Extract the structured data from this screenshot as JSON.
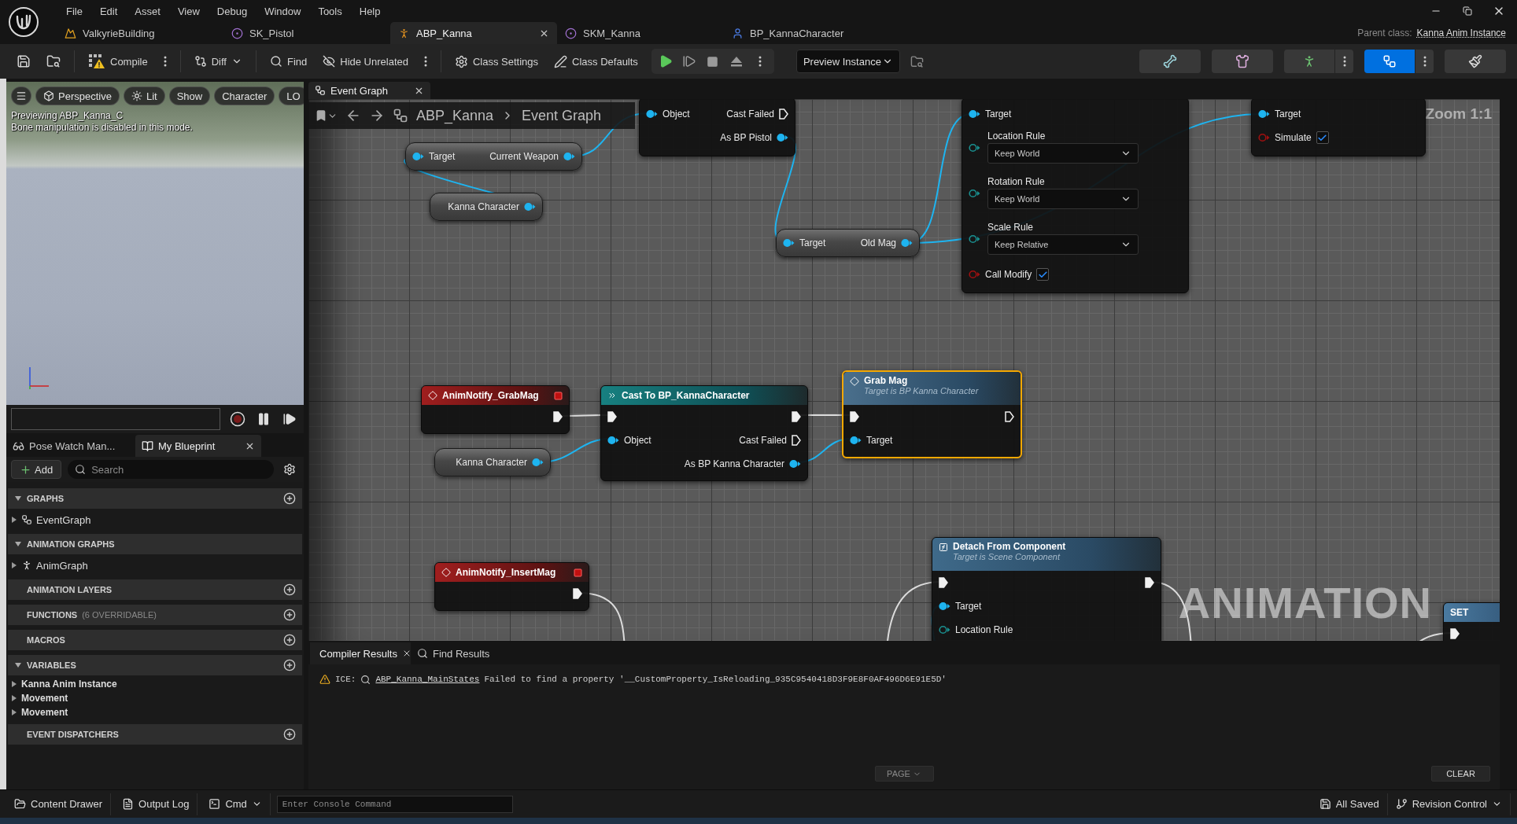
{
  "menu": [
    "File",
    "Edit",
    "Asset",
    "View",
    "Debug",
    "Window",
    "Tools",
    "Help"
  ],
  "document_tabs": [
    {
      "label": "ValkyrieBuilding",
      "kind": "level",
      "selected": false
    },
    {
      "label": "SK_Pistol",
      "kind": "skeleton",
      "selected": false
    },
    {
      "label": "ABP_Kanna",
      "kind": "anim_blueprint",
      "selected": true
    },
    {
      "label": "SKM_Kanna",
      "kind": "mesh",
      "selected": false
    },
    {
      "label": "BP_KannaCharacter",
      "kind": "blueprint",
      "selected": false
    }
  ],
  "parent_class": {
    "label": "Parent class:",
    "value": "Kanna Anim Instance"
  },
  "toolbar": {
    "compile": "Compile",
    "diff": "Diff",
    "find": "Find",
    "hide_unrelated": "Hide Unrelated",
    "class_settings": "Class Settings",
    "class_defaults": "Class Defaults",
    "debug_object": "Preview Instance",
    "modes": [
      {
        "kind": "skeleton",
        "selected": false,
        "menu": false
      },
      {
        "kind": "mesh",
        "selected": false,
        "menu": false
      },
      {
        "kind": "animation",
        "selected": false,
        "menu": true
      },
      {
        "kind": "graph",
        "selected": true,
        "menu": true
      },
      {
        "kind": "physics",
        "selected": false,
        "menu": false
      }
    ]
  },
  "viewport": {
    "buttons": [
      {
        "label": "Perspective",
        "kind": "camera"
      },
      {
        "label": "Lit",
        "kind": "lighting"
      },
      {
        "label": "Show",
        "kind": "plain"
      },
      {
        "label": "Character",
        "kind": "plain"
      },
      {
        "label": "LO",
        "kind": "plain"
      }
    ],
    "messages": [
      "Previewing ABP_Kanna_C",
      "Bone manipulation is disabled in this mode."
    ]
  },
  "panel_tabs": [
    {
      "label": "Pose Watch Man...",
      "kind": "pose_watch",
      "selected": false
    },
    {
      "label": "My Blueprint",
      "kind": "blueprint",
      "selected": true
    }
  ],
  "my_blueprint": {
    "add": "Add",
    "search": {
      "placeholder": "Search"
    },
    "sections": [
      {
        "title": "GRAPHS",
        "expanded": true,
        "addable": true,
        "items": [
          {
            "label": "EventGraph",
            "kind": "graph",
            "expanded": false
          }
        ]
      },
      {
        "title": "ANIMATION GRAPHS",
        "expanded": true,
        "addable": false,
        "items": [
          {
            "label": "AnimGraph",
            "kind": "anim_graph",
            "expanded": false
          }
        ]
      },
      {
        "title": "ANIMATION LAYERS",
        "expanded": false,
        "addable": true
      },
      {
        "title": "FUNCTIONS",
        "note": "(6 OVERRIDABLE)",
        "expanded": false,
        "addable": true
      },
      {
        "title": "MACROS",
        "expanded": false,
        "addable": true
      },
      {
        "title": "VARIABLES",
        "expanded": true,
        "addable": true,
        "items": [
          {
            "label": "Kanna Anim Instance",
            "kind": "category",
            "expanded": false
          },
          {
            "label": "Movement",
            "kind": "category",
            "expanded": false
          },
          {
            "label": "Movement",
            "kind": "category",
            "expanded": false
          }
        ]
      },
      {
        "title": "EVENT DISPATCHERS",
        "expanded": false,
        "addable": true
      }
    ]
  },
  "graph": {
    "tab": "Event Graph",
    "breadcrumb": [
      "ABP_Kanna",
      "Event Graph"
    ],
    "zoom": "Zoom 1:1",
    "watermark": "ANIMATION",
    "nodes": [
      {
        "kind": "variable",
        "selected": false,
        "rows": [
          {
            "kind": "pins",
            "left": {
              "kind": "object",
              "connected": true,
              "label": "Target"
            },
            "right": {
              "kind": "object",
              "connected": true,
              "label": "Current Weapon"
            }
          }
        ]
      },
      {
        "kind": "variable",
        "selected": false,
        "rows": [
          {
            "kind": "pins",
            "right": {
              "kind": "object",
              "connected": true,
              "label": "Kanna Character"
            }
          }
        ]
      },
      {
        "kind": "partial",
        "selected": false,
        "rows": [
          {
            "kind": "pins",
            "left": {
              "kind": "object",
              "connected": true,
              "label": "Object"
            },
            "right": {
              "kind": "exec",
              "connected": false,
              "label": "Cast Failed"
            }
          },
          {
            "kind": "pins",
            "right": {
              "kind": "object",
              "connected": true,
              "label": "As BP Pistol"
            }
          }
        ]
      },
      {
        "kind": "variable",
        "selected": false,
        "rows": [
          {
            "kind": "pins",
            "left": {
              "kind": "object",
              "connected": true,
              "label": "Target"
            },
            "right": {
              "kind": "object",
              "connected": true,
              "label": "Old Mag"
            }
          }
        ]
      },
      {
        "kind": "partial",
        "selected": false,
        "rows": [
          {
            "kind": "pins",
            "left": {
              "kind": "object",
              "connected": true,
              "label": "Target"
            }
          },
          {
            "kind": "dropdown",
            "pin": {
              "kind": "struct",
              "connected": false
            },
            "label": "Location Rule",
            "value": "Keep World"
          },
          {
            "kind": "dropdown",
            "pin": {
              "kind": "struct",
              "connected": false
            },
            "label": "Rotation Rule",
            "value": "Keep World"
          },
          {
            "kind": "dropdown",
            "pin": {
              "kind": "struct",
              "connected": false
            },
            "label": "Scale Rule",
            "value": "Keep Relative"
          },
          {
            "kind": "checkbox",
            "pin": {
              "kind": "bool",
              "connected": false
            },
            "label": "Call Modify",
            "checked": true
          }
        ]
      },
      {
        "kind": "partial",
        "selected": false,
        "rows": [
          {
            "kind": "pins",
            "left": {
              "kind": "object",
              "connected": true,
              "label": "Target"
            }
          },
          {
            "kind": "checkbox",
            "pin": {
              "kind": "bool",
              "connected": false
            },
            "label": "Simulate",
            "checked": true
          }
        ]
      },
      {
        "kind": "event",
        "title": "AnimNotify_GrabMag",
        "selected": false,
        "rows": [
          {
            "kind": "pins",
            "right": {
              "kind": "exec",
              "connected": true
            }
          }
        ]
      },
      {
        "kind": "variable",
        "selected": false,
        "rows": [
          {
            "kind": "pins",
            "right": {
              "kind": "object",
              "connected": true,
              "label": "Kanna Character"
            }
          }
        ]
      },
      {
        "kind": "cast",
        "title": "Cast To BP_KannaCharacter",
        "selected": false,
        "rows": [
          {
            "kind": "pins",
            "left": {
              "kind": "exec",
              "connected": true
            },
            "right": {
              "kind": "exec",
              "connected": true
            }
          },
          {
            "kind": "pins",
            "left": {
              "kind": "object",
              "connected": true,
              "label": "Object"
            },
            "right": {
              "kind": "exec",
              "connected": false,
              "label": "Cast Failed"
            }
          },
          {
            "kind": "pins",
            "right": {
              "kind": "object",
              "connected": true,
              "label": "As BP Kanna Character"
            }
          }
        ]
      },
      {
        "kind": "message",
        "title": "Grab Mag",
        "subtitle": "Target is BP Kanna Character",
        "selected": true,
        "rows": [
          {
            "kind": "pins",
            "left": {
              "kind": "exec",
              "connected": true
            },
            "right": {
              "kind": "exec",
              "connected": false
            }
          },
          {
            "kind": "pins",
            "left": {
              "kind": "object",
              "connected": true,
              "label": "Target"
            }
          }
        ]
      },
      {
        "kind": "function",
        "title": "Detach From Component",
        "subtitle": "Target is Scene Component",
        "selected": false,
        "rows": [
          {
            "kind": "pins",
            "left": {
              "kind": "exec",
              "connected": true
            },
            "right": {
              "kind": "exec",
              "connected": true
            }
          },
          {
            "kind": "pins",
            "left": {
              "kind": "object",
              "connected": true,
              "label": "Target"
            }
          },
          {
            "kind": "pins",
            "left": {
              "kind": "struct",
              "connected": false,
              "label": "Location Rule"
            }
          }
        ]
      },
      {
        "kind": "event",
        "title": "AnimNotify_InsertMag",
        "selected": false,
        "rows": [
          {
            "kind": "pins",
            "right": {
              "kind": "exec",
              "connected": true
            }
          }
        ]
      },
      {
        "kind": "set",
        "title": "SET",
        "selected": false,
        "rows": [
          {
            "kind": "pins",
            "left": {
              "kind": "exec",
              "connected": true
            }
          }
        ]
      }
    ]
  },
  "results": {
    "tabs": [
      {
        "label": "Compiler Results",
        "kind": "compiler",
        "selected": true
      },
      {
        "label": "Find Results",
        "kind": "find",
        "selected": false
      }
    ],
    "messages": [
      {
        "kind": "warning",
        "prefix": "ICE:",
        "link": "ABP_Kanna_MainStates",
        "text": "Failed to find a property '__CustomProperty_IsReloading_935C9540418D3F9E8F0AF496D6E91E5D'"
      }
    ],
    "page": "PAGE",
    "clear": "CLEAR"
  },
  "status_bar": {
    "content_drawer": "Content Drawer",
    "output_log": "Output Log",
    "cmd": "Cmd",
    "console": {
      "placeholder": "Enter Console Command"
    },
    "saved": "All Saved",
    "revision_control": "Revision Control"
  }
}
